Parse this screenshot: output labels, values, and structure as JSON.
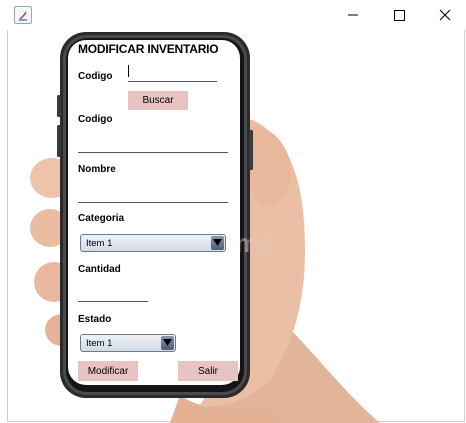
{
  "window": {
    "icon": "java-app-icon",
    "controls": [
      "minimize-icon",
      "maximize-icon",
      "close-icon"
    ]
  },
  "form": {
    "title": "MODIFICAR INVENTARIO",
    "codigo_search_label": "Codigo",
    "codigo_search_value": "",
    "buscar_label": "Buscar",
    "codigo_label": "Codigo",
    "codigo_value": "",
    "nombre_label": "Nombre",
    "nombre_value": "",
    "categoria_label": "Categoria",
    "categoria_selected": "Item 1",
    "cantidad_label": "Cantidad",
    "cantidad_value": "",
    "estado_label": "Estado",
    "estado_selected": "Item 1",
    "modificar_label": "Modificar",
    "salir_label": "Salir"
  },
  "colors": {
    "button_bg": "#e7c4c1",
    "combo_arrow": "#5a6880"
  }
}
